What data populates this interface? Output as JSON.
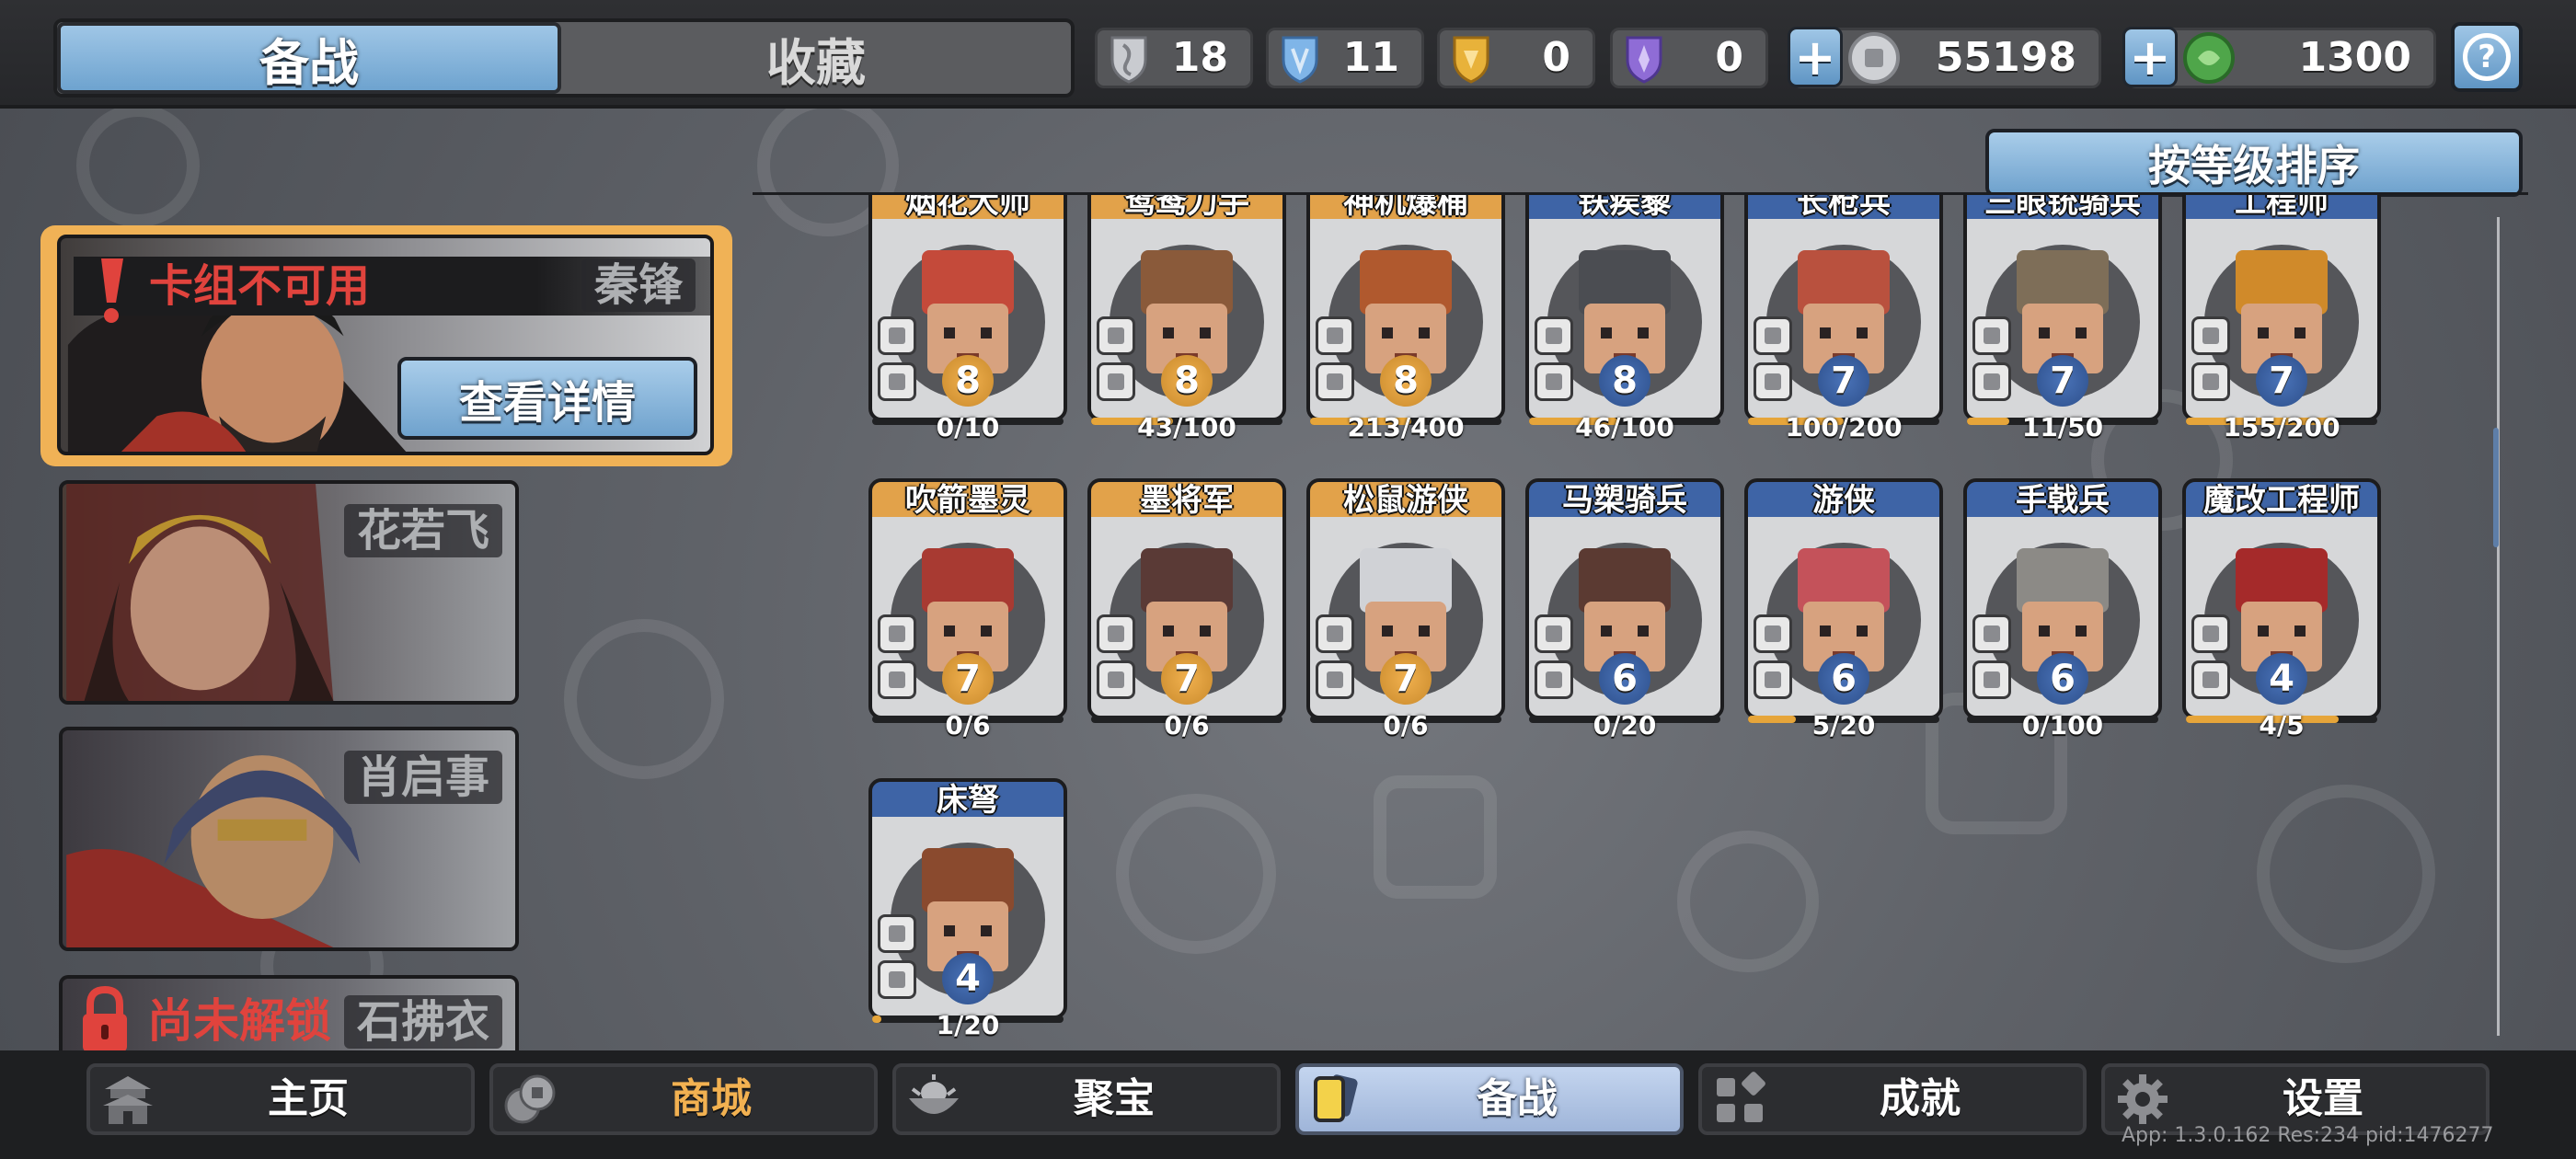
{
  "header": {
    "tabs": [
      {
        "label": "备战",
        "active": true
      },
      {
        "label": "收藏",
        "active": false
      }
    ],
    "resources": [
      {
        "icon": "silver-shield-icon",
        "value": "18",
        "color": "#c9cbd0"
      },
      {
        "icon": "blue-shield-icon",
        "value": "11",
        "color": "#7fb5e8"
      },
      {
        "icon": "gold-shield-icon",
        "value": "0",
        "color": "#e8b23a"
      },
      {
        "icon": "purple-shield-icon",
        "value": "0",
        "color": "#8f6cd6"
      }
    ],
    "currencies": [
      {
        "icon": "silver-coin-icon",
        "value": "55198",
        "plus": "+"
      },
      {
        "icon": "jade-coin-icon",
        "value": "1300",
        "plus": "+"
      }
    ],
    "help": "?"
  },
  "sort_button": "按等级排序",
  "commanders": [
    {
      "name": "秦锋",
      "status": "卡组不可用",
      "details_button": "查看详情",
      "selected": true
    },
    {
      "name": "花若飞"
    },
    {
      "name": "肖启事"
    },
    {
      "name": "石拂衣",
      "status": "尚未解锁",
      "locked": true
    }
  ],
  "units": [
    {
      "name": "烟花大师",
      "level": 8,
      "progress": "0/10",
      "fill": 0.0,
      "rarity": "gold"
    },
    {
      "name": "鸳鸯刀手",
      "level": 8,
      "progress": "43/100",
      "fill": 0.43,
      "rarity": "gold"
    },
    {
      "name": "神机爆桶",
      "level": 8,
      "progress": "213/400",
      "fill": 0.53,
      "rarity": "gold"
    },
    {
      "name": "铁蒺藜",
      "level": 8,
      "progress": "46/100",
      "fill": 0.46,
      "rarity": "blue"
    },
    {
      "name": "长枪兵",
      "level": 7,
      "progress": "100/200",
      "fill": 0.5,
      "rarity": "blue"
    },
    {
      "name": "三眼铳骑兵",
      "level": 7,
      "progress": "11/50",
      "fill": 0.22,
      "rarity": "blue"
    },
    {
      "name": "工程师",
      "level": 7,
      "progress": "155/200",
      "fill": 0.78,
      "rarity": "blue"
    },
    {
      "name": "吹箭墨灵",
      "level": 7,
      "progress": "0/6",
      "fill": 0.0,
      "rarity": "gold"
    },
    {
      "name": "墨将军",
      "level": 7,
      "progress": "0/6",
      "fill": 0.0,
      "rarity": "gold"
    },
    {
      "name": "松鼠游侠",
      "level": 7,
      "progress": "0/6",
      "fill": 0.0,
      "rarity": "gold"
    },
    {
      "name": "马槊骑兵",
      "level": 6,
      "progress": "0/20",
      "fill": 0.0,
      "rarity": "blue"
    },
    {
      "name": "游侠",
      "level": 6,
      "progress": "5/20",
      "fill": 0.25,
      "rarity": "blue"
    },
    {
      "name": "手戟兵",
      "level": 6,
      "progress": "0/100",
      "fill": 0.0,
      "rarity": "blue"
    },
    {
      "name": "魔改工程师",
      "level": 4,
      "progress": "4/5",
      "fill": 0.8,
      "rarity": "blue"
    },
    {
      "name": "床弩",
      "level": 4,
      "progress": "1/20",
      "fill": 0.05,
      "rarity": "blue"
    }
  ],
  "bottom_nav": [
    {
      "label": "主页",
      "icon": "pagoda-icon"
    },
    {
      "label": "商城",
      "icon": "coins-icon",
      "highlight": "#f2b151"
    },
    {
      "label": "聚宝",
      "icon": "treasure-bowl-icon"
    },
    {
      "label": "备战",
      "icon": "cards-icon",
      "active": true
    },
    {
      "label": "成就",
      "icon": "grid-badge-icon"
    },
    {
      "label": "设置",
      "icon": "gear-icon"
    }
  ],
  "version": "App: 1.3.0.162 Res:234 pid:1476277"
}
